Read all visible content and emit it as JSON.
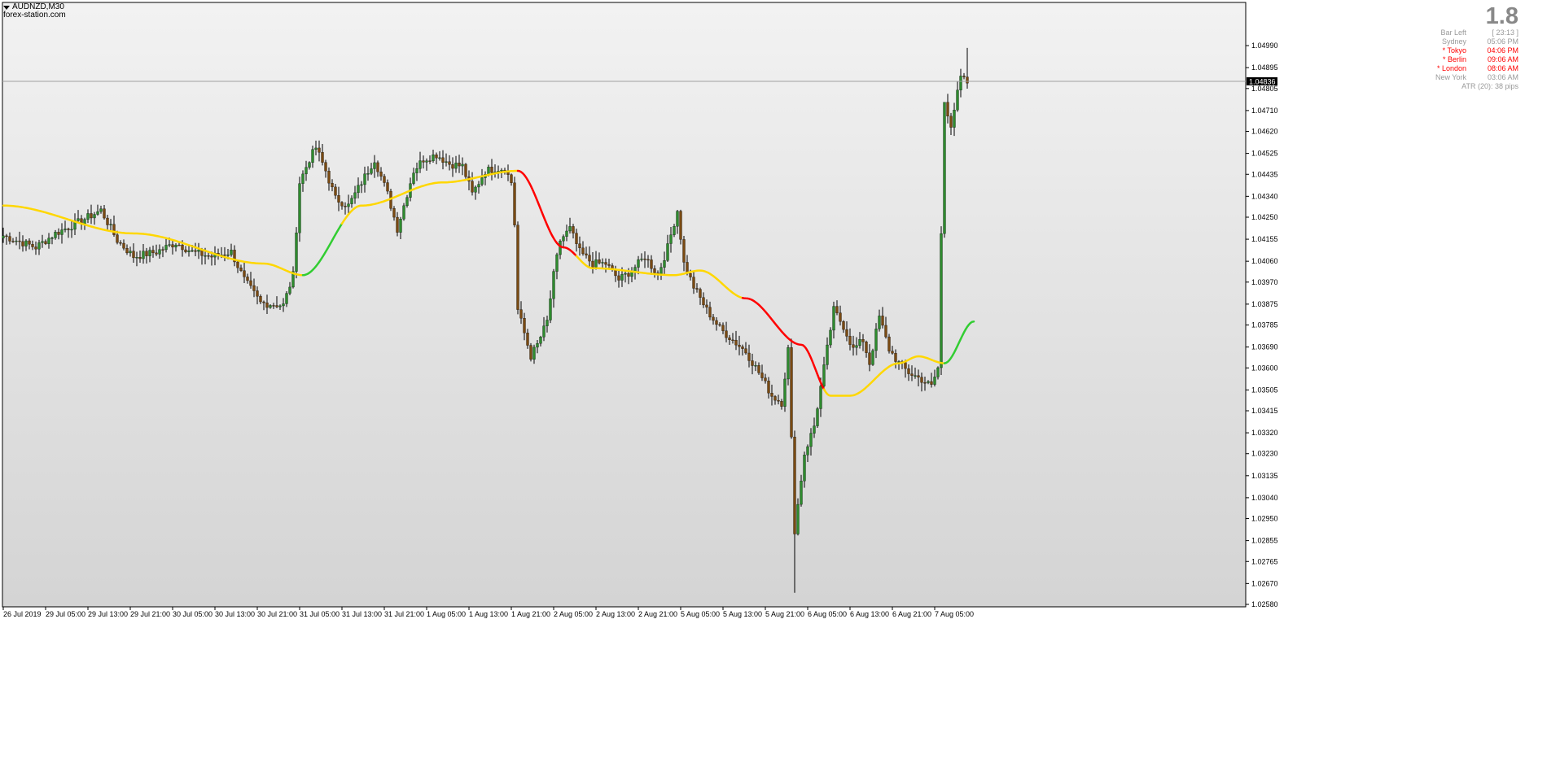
{
  "header": {
    "symbol": "AUDNZD,M30",
    "watermark": "forex-station.com"
  },
  "info_panel": {
    "big_value": "1.8",
    "rows": [
      {
        "label": "Bar Left",
        "value": "[ 23:13 ]",
        "highlight": false
      },
      {
        "label": "Sydney",
        "value": "05:06 PM",
        "highlight": false
      },
      {
        "label": "* Tokyo",
        "value": "04:06 PM",
        "highlight": true
      },
      {
        "label": "* Berlin",
        "value": "09:06 AM",
        "highlight": true
      },
      {
        "label": "* London",
        "value": "08:06 AM",
        "highlight": true
      },
      {
        "label": "New York",
        "value": "03:06 AM",
        "highlight": false
      }
    ],
    "atr": "ATR (20): 38 pips"
  },
  "colors": {
    "bull": "#2e8b2e",
    "bear": "#7a4a12",
    "ma_flat": "#ffd700",
    "ma_up": "#32cd32",
    "ma_down": "#ff0000",
    "price_line": "#a0a0a0",
    "current_price_box": "#000000"
  },
  "chart_data": {
    "type": "candlestick",
    "title": "AUDNZD,M30",
    "ylim": [
      1.0258,
      1.05085
    ],
    "y_ticks": [
      "1.04990",
      "1.04895",
      "1.04805",
      "1.04710",
      "1.04620",
      "1.04525",
      "1.04435",
      "1.04340",
      "1.04250",
      "1.04155",
      "1.04060",
      "1.03970",
      "1.03875",
      "1.03785",
      "1.03690",
      "1.03600",
      "1.03505",
      "1.03415",
      "1.03320",
      "1.03230",
      "1.03135",
      "1.03040",
      "1.02950",
      "1.02855",
      "1.02765",
      "1.02670",
      "1.02580"
    ],
    "current_price": "1.04836",
    "x_ticks": [
      "26 Jul 2019",
      "29 Jul 05:00",
      "29 Jul 13:00",
      "29 Jul 21:00",
      "30 Jul 05:00",
      "30 Jul 13:00",
      "30 Jul 21:00",
      "31 Jul 05:00",
      "31 Jul 13:00",
      "31 Jul 21:00",
      "1 Aug 05:00",
      "1 Aug 13:00",
      "1 Aug 21:00",
      "2 Aug 05:00",
      "2 Aug 13:00",
      "2 Aug 21:00",
      "5 Aug 05:00",
      "5 Aug 13:00",
      "5 Aug 21:00",
      "6 Aug 05:00",
      "6 Aug 13:00",
      "6 Aug 21:00",
      "7 Aug 05:00"
    ],
    "key_closes": [
      [
        0,
        1.0417
      ],
      [
        10,
        1.0412
      ],
      [
        16,
        1.0418
      ],
      [
        22,
        1.0422
      ],
      [
        30,
        1.0428
      ],
      [
        35,
        1.0415
      ],
      [
        40,
        1.0408
      ],
      [
        47,
        1.041
      ],
      [
        53,
        1.0414
      ],
      [
        58,
        1.041
      ],
      [
        64,
        1.0408
      ],
      [
        70,
        1.041
      ],
      [
        74,
        1.0398
      ],
      [
        79,
        1.0388
      ],
      [
        86,
        1.0387
      ],
      [
        89,
        1.04
      ],
      [
        91,
        1.044
      ],
      [
        94,
        1.045
      ],
      [
        96,
        1.0455
      ],
      [
        99,
        1.0445
      ],
      [
        102,
        1.0433
      ],
      [
        106,
        1.043
      ],
      [
        110,
        1.044
      ],
      [
        114,
        1.045
      ],
      [
        118,
        1.0435
      ],
      [
        121,
        1.042
      ],
      [
        123,
        1.043
      ],
      [
        126,
        1.0445
      ],
      [
        129,
        1.045
      ],
      [
        133,
        1.0452
      ],
      [
        137,
        1.0448
      ],
      [
        141,
        1.0447
      ],
      [
        144,
        1.0435
      ],
      [
        148,
        1.0445
      ],
      [
        151,
        1.0446
      ],
      [
        154,
        1.0446
      ],
      [
        156,
        1.044
      ],
      [
        157,
        1.0422
      ],
      [
        158,
        1.0385
      ],
      [
        160,
        1.0375
      ],
      [
        162,
        1.0365
      ],
      [
        164,
        1.037
      ],
      [
        167,
        1.038
      ],
      [
        169,
        1.04
      ],
      [
        171,
        1.0415
      ],
      [
        174,
        1.042
      ],
      [
        177,
        1.041
      ],
      [
        181,
        1.0405
      ],
      [
        185,
        1.0405
      ],
      [
        189,
        1.0398
      ],
      [
        193,
        1.0402
      ],
      [
        197,
        1.0408
      ],
      [
        201,
        1.04
      ],
      [
        204,
        1.0412
      ],
      [
        207,
        1.0428
      ],
      [
        209,
        1.0405
      ],
      [
        212,
        1.0395
      ],
      [
        216,
        1.0385
      ],
      [
        220,
        1.0377
      ],
      [
        224,
        1.0372
      ],
      [
        228,
        1.0367
      ],
      [
        232,
        1.0358
      ],
      [
        236,
        1.0348
      ],
      [
        239,
        1.0345
      ],
      [
        241,
        1.0368
      ],
      [
        243,
        1.029
      ],
      [
        246,
        1.0323
      ],
      [
        249,
        1.0335
      ],
      [
        252,
        1.036
      ],
      [
        255,
        1.0385
      ],
      [
        258,
        1.0378
      ],
      [
        261,
        1.0368
      ],
      [
        264,
        1.0372
      ],
      [
        266,
        1.0362
      ],
      [
        269,
        1.0382
      ],
      [
        272,
        1.0368
      ],
      [
        275,
        1.0362
      ],
      [
        278,
        1.0358
      ],
      [
        282,
        1.0355
      ],
      [
        285,
        1.0352
      ],
      [
        287,
        1.036
      ],
      [
        289,
        1.0475
      ],
      [
        291,
        1.0465
      ],
      [
        294,
        1.0485
      ],
      [
        296,
        1.0483
      ]
    ],
    "ma_colors": [
      "flat",
      "up",
      "flat",
      "down",
      "flat",
      "down",
      "flat",
      "up"
    ],
    "ma_points": [
      [
        0,
        1.043
      ],
      [
        40,
        1.0418
      ],
      [
        80,
        1.0405
      ],
      [
        92,
        1.04
      ],
      [
        110,
        1.043
      ],
      [
        135,
        1.044
      ],
      [
        158,
        1.0445
      ],
      [
        172,
        1.0412
      ],
      [
        181,
        1.0403
      ],
      [
        206,
        1.04
      ],
      [
        214,
        1.0402
      ],
      [
        228,
        1.039
      ],
      [
        245,
        1.037
      ],
      [
        254,
        1.0348
      ],
      [
        260,
        1.0348
      ],
      [
        275,
        1.0362
      ],
      [
        281,
        1.0365
      ],
      [
        289,
        1.0362
      ],
      [
        298,
        1.038
      ]
    ],
    "ma_segment_breaks": [
      92,
      104,
      158,
      176,
      227,
      252,
      289
    ]
  }
}
